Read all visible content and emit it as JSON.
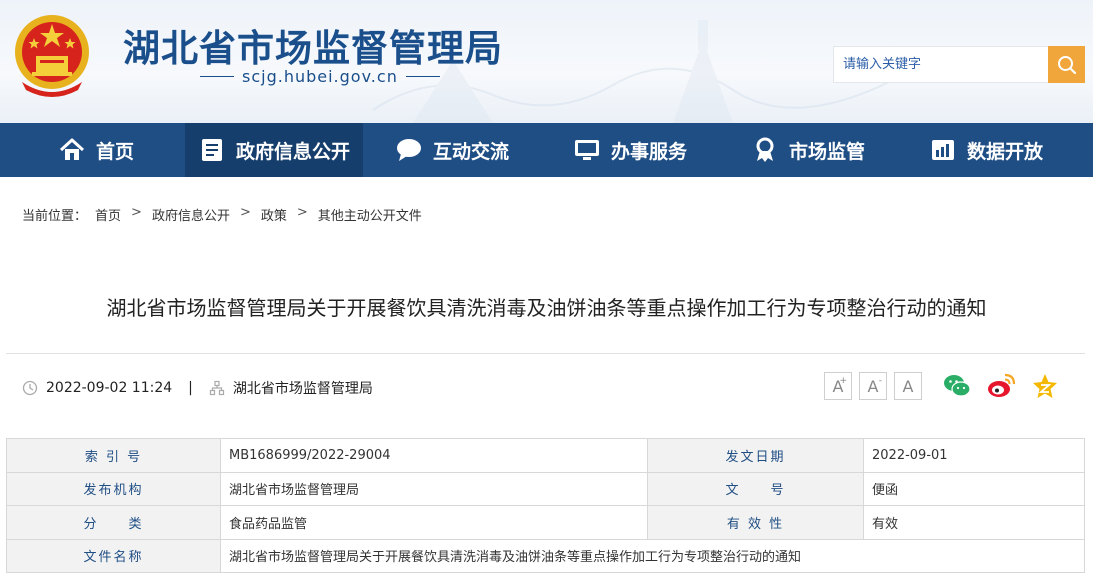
{
  "header": {
    "title": "湖北省市场监督管理局",
    "url": "scjg.hubei.gov.cn",
    "search_placeholder": "请输入关键字"
  },
  "nav": {
    "items": [
      {
        "label": "首页",
        "icon": "home-icon"
      },
      {
        "label": "政府信息公开",
        "icon": "document-list-icon"
      },
      {
        "label": "互动交流",
        "icon": "chat-bubble-icon"
      },
      {
        "label": "办事服务",
        "icon": "monitor-icon"
      },
      {
        "label": "市场监管",
        "icon": "badge-icon"
      },
      {
        "label": "数据开放",
        "icon": "bar-chart-icon"
      }
    ],
    "active_index": 1
  },
  "breadcrumb": {
    "prefix": "当前位置：",
    "items": [
      "首页",
      "政府信息公开",
      "政策",
      "其他主动公开文件"
    ],
    "separator": ">"
  },
  "article": {
    "title": "湖北省市场监督管理局关于开展餐饮具清洗消毒及油饼油条等重点操作加工行为专项整治行动的通知",
    "datetime": "2022-09-02 11:24",
    "divider": "|",
    "source": "湖北省市场监督管理局"
  },
  "tools": {
    "font_large": "A",
    "font_medium": "A",
    "font_small": "A",
    "large_sup": "+",
    "medium_sup": "-",
    "share_icons": [
      "wechat-icon",
      "weibo-icon",
      "favorite-star-icon"
    ]
  },
  "info_table": {
    "rows": [
      {
        "l1": "索 引 号",
        "v1": "MB1686999/2022-29004",
        "l2": "发文日期",
        "v2": "2022-09-01"
      },
      {
        "l1": "发布机构",
        "v1": "湖北省市场监督管理局",
        "l2": "文　　号",
        "v2": "便函"
      },
      {
        "l1": "分　　类",
        "v1": "食品药品监管",
        "l2": "有 效 性",
        "v2": "有效"
      }
    ],
    "name_label": "文件名称",
    "name_value": "湖北省市场监督管理局关于开展餐饮具清洗消毒及油饼油条等重点操作加工行为专项整治行动的通知"
  },
  "colors": {
    "brand_blue": "#1f4e85",
    "nav_active": "#163e6c",
    "search_button": "#f0a63a"
  }
}
